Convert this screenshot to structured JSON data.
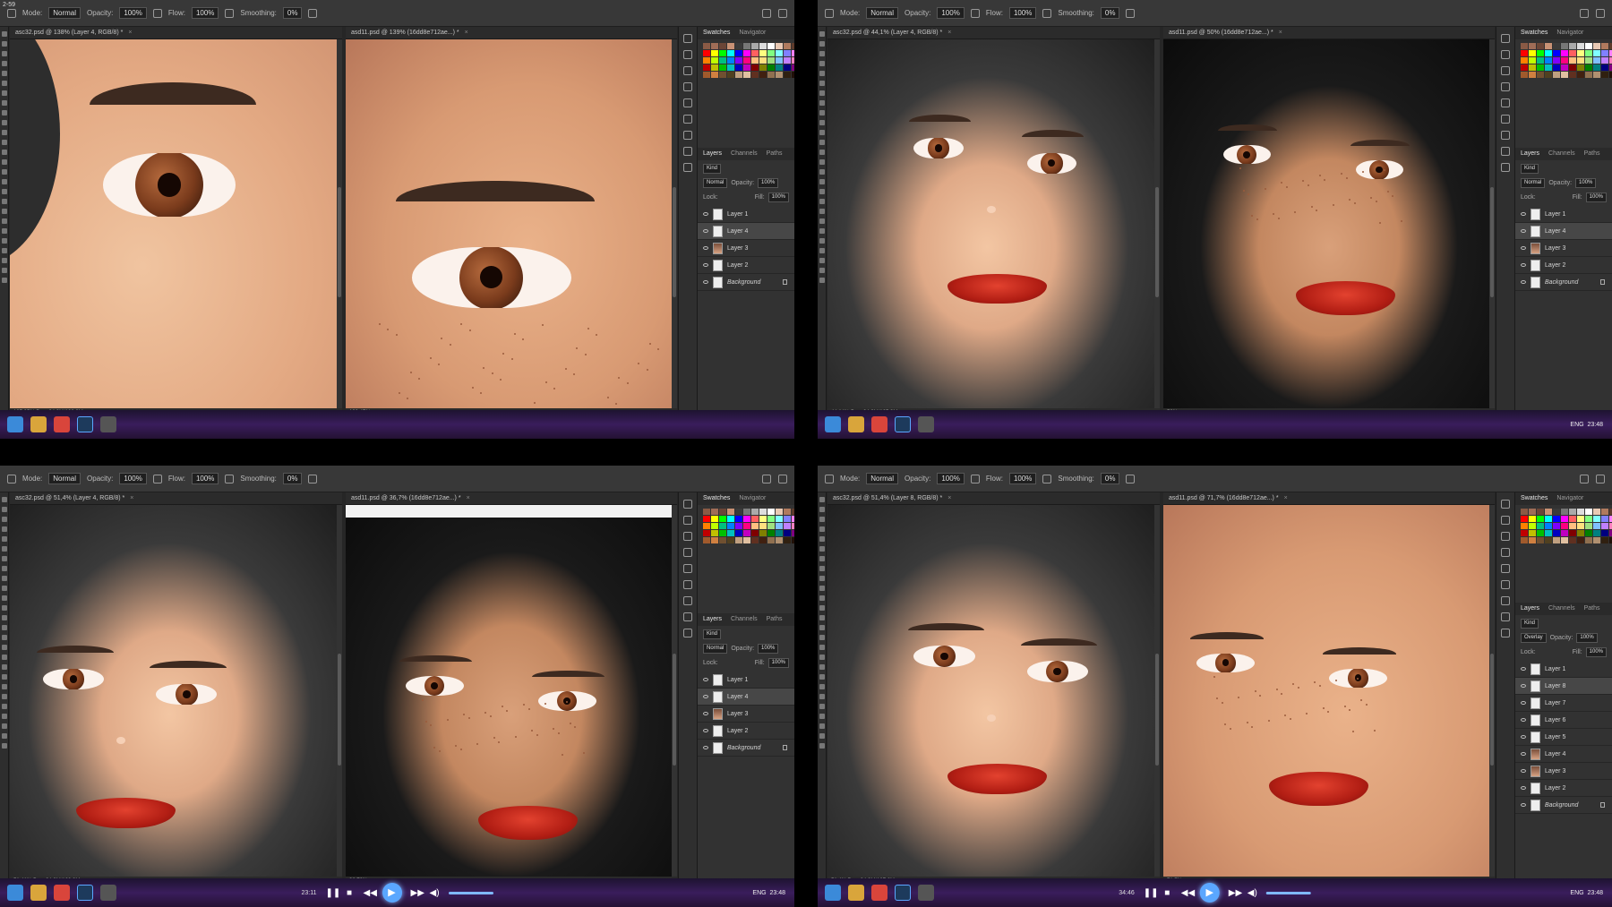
{
  "clock": "2-59",
  "panels": {
    "swatches_tab": "Swatches",
    "navigator_tab": "Navigator",
    "layers_tab": "Layers",
    "channels_tab": "Channels",
    "paths_tab": "Paths",
    "kind": "Kind",
    "blend_normal": "Normal",
    "blend_overlay": "Overlay",
    "opacity_label": "Opacity:",
    "opacity_value": "100%",
    "fill_label": "Fill:",
    "lock_label": "Lock:",
    "layers_basic": [
      "Layer 1",
      "Layer 4",
      "Layer 3",
      "Layer 2",
      "Background"
    ],
    "layers_q4": [
      "Layer 1",
      "Layer 8",
      "Layer 7",
      "Layer 6",
      "Layer 5",
      "Layer 4",
      "Layer 3",
      "Layer 2",
      "Background"
    ]
  },
  "options": {
    "mode_label": "Mode:",
    "mode_value": "Normal",
    "opacity_label": "Opacity:",
    "opacity_value": "100%",
    "flow_label": "Flow:",
    "flow_value": "100%",
    "smoothing_label": "Smoothing:",
    "smoothing_value": "0%"
  },
  "quadrants": [
    {
      "doc1_tab": "asc32.psd @ 138% (Layer 4, RGB/8) *",
      "doc2_tab": "asd11.psd @ 139% (16dd8e712ae...) *",
      "doc1_status": "137,95%    Doc: 24,9M/100,9M",
      "doc2_status": "139,47%",
      "time": ""
    },
    {
      "doc1_tab": "asc32.psd @ 44,1% (Layer 4, RGB/8) *",
      "doc2_tab": "asd11.psd @ 50% (16dd8e712ae...) *",
      "doc1_status": "44,14%    Doc: 24,9M/105,3M",
      "doc2_status": "50%",
      "time": ""
    },
    {
      "doc1_tab": "asc32.psd @ 51,4% (Layer 4, RGB/8) *",
      "doc2_tab": "asd11.psd @ 36,7% (16dd8e712ae...) *",
      "doc1_status": "51,41%    Doc: 24,9M/100,9M",
      "doc2_status": "36,72%",
      "time": "23:11"
    },
    {
      "doc1_tab": "asc32.psd @ 51,4% (Layer 8, RGB/8) *",
      "doc2_tab": "asd11.psd @ 71,7% (16dd8e712ae...) *",
      "doc1_status": "51,4%    Doc: 24,9M/187,6M",
      "doc2_status": "71,7%",
      "time": "34:46"
    }
  ],
  "tray": {
    "lang": "ENG",
    "clock": "23:48"
  },
  "colors": {
    "panel": "#323232",
    "canvas_bg": "#454545",
    "lips": "#c0261a",
    "iris": "#7a3b1c",
    "taskbar": "#3a1d5c",
    "accent": "#5aa7ff"
  },
  "icons": [
    "search-icon",
    "brush-icon",
    "play-icon",
    "pause-icon",
    "stop-icon",
    "prev-icon",
    "next-icon",
    "volume-icon",
    "eye-icon",
    "lock-icon"
  ]
}
